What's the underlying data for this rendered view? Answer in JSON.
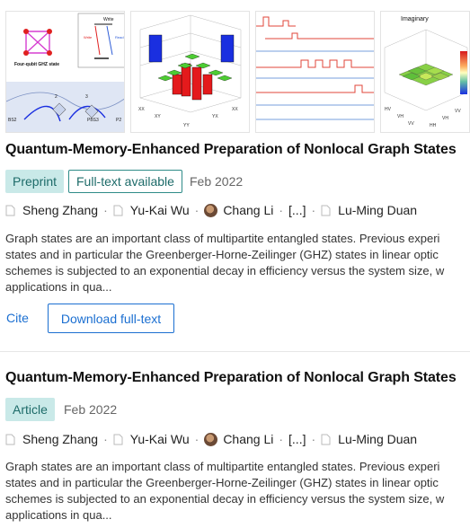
{
  "results": [
    {
      "title": "Quantum-Memory-Enhanced Preparation of Nonlocal Graph States",
      "badges": [
        "Preprint",
        "Full-text available"
      ],
      "date": "Feb 2022",
      "authors": [
        "Sheng Zhang",
        "Yu-Kai Wu",
        "Chang Li",
        "[...]",
        "Lu-Ming Duan"
      ],
      "abstract_lines": [
        "Graph states are an important class of multipartite entangled states. Previous experi",
        "states and in particular the Greenberger-Horne-Zeilinger (GHZ) states in linear optic",
        "schemes is subjected to an exponential decay in efficiency versus the system size, w",
        "applications in qua..."
      ],
      "cite_label": "Cite",
      "download_label": "Download full-text",
      "figure_labels": {
        "ghz": "Four-qubit GHZ state",
        "write": "Write",
        "read": "Read",
        "imaginary": "Imaginary",
        "axis_xx": "XX",
        "axis_xy": "XY",
        "axis_yx": "YX",
        "axis_yy": "YY",
        "axis_hv": "HV",
        "axis_vh": "VH",
        "axis_vv": "VV",
        "axis_hh": "HH",
        "bs2": "BS2",
        "pbs": "PBS3",
        "p2": "P2",
        "num2": "2",
        "num3": "3"
      }
    },
    {
      "title": "Quantum-Memory-Enhanced Preparation of Nonlocal Graph States",
      "badges": [
        "Article"
      ],
      "date": "Feb 2022",
      "authors": [
        "Sheng Zhang",
        "Yu-Kai Wu",
        "Chang Li",
        "[...]",
        "Lu-Ming Duan"
      ],
      "abstract_lines": [
        "Graph states are an important class of multipartite entangled states. Previous experi",
        "states and in particular the Greenberger-Horne-Zeilinger (GHZ) states in linear optic",
        "schemes is subjected to an exponential decay in efficiency versus the system size, w",
        "applications in qua..."
      ]
    }
  ],
  "colors": {
    "accent": "#1b6fd1",
    "badge_fill": "#c9e9e8",
    "badge_text": "#1d6b69",
    "bar_red": "#e41a1c",
    "bar_green": "#4dcc33",
    "bar_blue": "#1a2fe0",
    "pulse_red": "#e0453a"
  }
}
